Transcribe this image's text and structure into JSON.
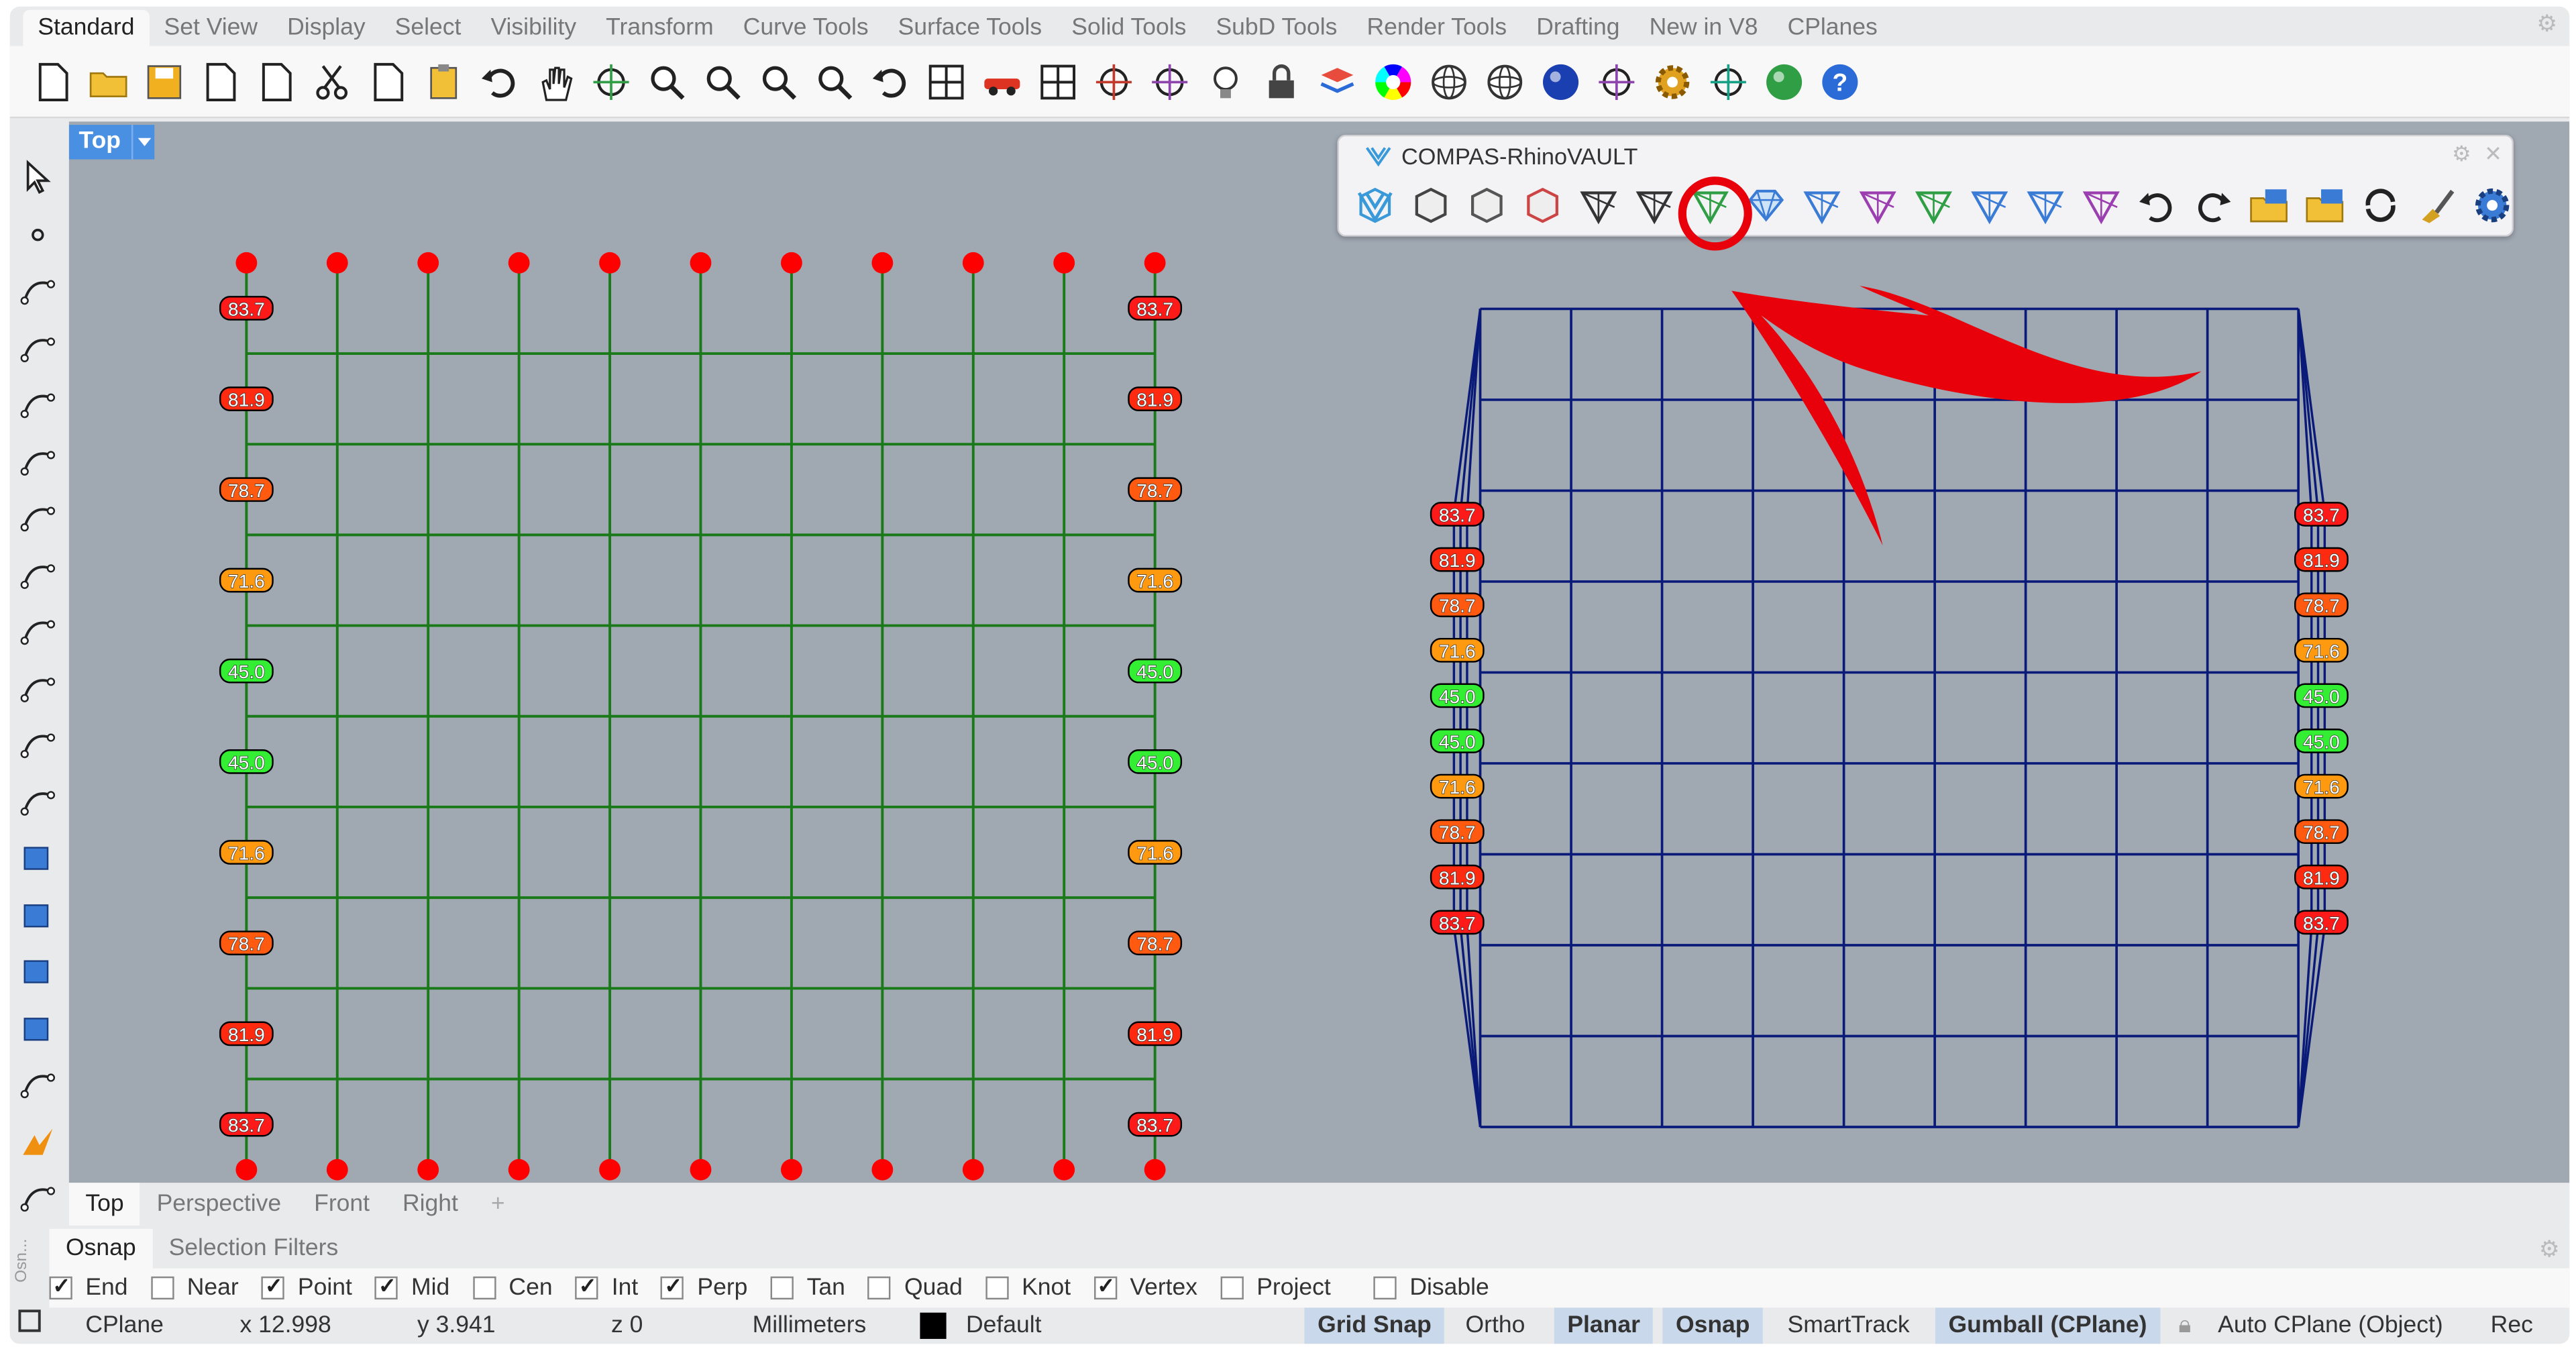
{
  "menu_tabs": [
    "Standard",
    "Set View",
    "Display",
    "Select",
    "Visibility",
    "Transform",
    "Curve Tools",
    "Surface Tools",
    "Solid Tools",
    "SubD Tools",
    "Render Tools",
    "Drafting",
    "New in V8",
    "CPlanes"
  ],
  "toolbar_icons": [
    "new-file-icon",
    "open-folder-icon",
    "save-icon",
    "print-icon",
    "import-icon",
    "cut-icon",
    "copy-icon",
    "paste-icon",
    "undo-icon",
    "pan-hand-icon",
    "rotate-view-icon",
    "zoom-icon",
    "zoom-window-icon",
    "zoom-extents-icon",
    "zoom-selected-icon",
    "undo-view-icon",
    "four-viewports-icon",
    "car-icon",
    "grid-icon",
    "circle-point-icon",
    "point-cloud-icon",
    "lightbulb-icon",
    "lock-icon",
    "layer-icon",
    "color-wheel-icon",
    "sphere-icon",
    "wireframe-sphere-icon",
    "render-sphere-icon",
    "wand-icon",
    "gear-icon",
    "tree-icon",
    "globe-icon",
    "help-icon"
  ],
  "viewport": {
    "label": "Top"
  },
  "panel": {
    "title": "COMPAS-RhinoVAULT",
    "icons": [
      "rv-init-icon",
      "rv-pattern-icon",
      "rv-boundary-icon",
      "rv-supports-icon",
      "rv-form-icon",
      "rv-force-icon",
      "rv-thrust-icon",
      "rv-equilibrium-icon",
      "rv-modify-form-icon",
      "rv-modify-force-icon",
      "rv-modify-thrust-icon",
      "rv-edge-icon",
      "rv-vertex-icon",
      "rv-face-icon",
      "rv-undo-icon",
      "rv-redo-icon",
      "rv-open-icon",
      "rv-save-icon",
      "rv-reload-icon",
      "rv-clear-icon",
      "rv-settings-icon"
    ],
    "highlighted_icon_index": 7
  },
  "left_labels": [
    "83.7",
    "81.9",
    "78.7",
    "71.6",
    "45.0",
    "45.0",
    "71.6",
    "78.7",
    "81.9",
    "83.7"
  ],
  "right_labels": [
    "83.7",
    "81.9",
    "78.7",
    "71.6",
    "45.0",
    "45.0",
    "71.6",
    "78.7",
    "81.9",
    "83.7"
  ],
  "label_colors": {
    "83.7": "#ff1a1a",
    "81.9": "#ff2a10",
    "78.7": "#ff5a10",
    "71.6": "#ff9a10",
    "45.0": "#33ee33"
  },
  "viewport_tabs": [
    "Top",
    "Perspective",
    "Front",
    "Right"
  ],
  "osnap_tabs": [
    "Osnap",
    "Selection Filters"
  ],
  "osnap_items": [
    {
      "label": "End",
      "checked": true
    },
    {
      "label": "Near",
      "checked": false
    },
    {
      "label": "Point",
      "checked": true
    },
    {
      "label": "Mid",
      "checked": true
    },
    {
      "label": "Cen",
      "checked": false
    },
    {
      "label": "Int",
      "checked": true
    },
    {
      "label": "Perp",
      "checked": true
    },
    {
      "label": "Tan",
      "checked": false
    },
    {
      "label": "Quad",
      "checked": false
    },
    {
      "label": "Knot",
      "checked": false
    },
    {
      "label": "Vertex",
      "checked": true
    },
    {
      "label": "Project",
      "checked": false
    },
    {
      "label": "Disable",
      "checked": false
    }
  ],
  "status": {
    "cplane": "CPlane",
    "x": "x 12.998",
    "y": "y 3.941",
    "z": "z 0",
    "units": "Millimeters",
    "layer": "Default",
    "grid_snap": "Grid Snap",
    "ortho": "Ortho",
    "planar": "Planar",
    "osnap": "Osnap",
    "smarttrack": "SmartTrack",
    "gumball": "Gumball (CPlane)",
    "autocplane": "Auto CPlane (Object)",
    "rec": "Rec"
  },
  "colors": {
    "viewport_bg": "#a0a8b2",
    "form_grid": "#1a7a1a",
    "thrust_mesh": "#0a1a78",
    "support_point": "#ff0000",
    "callout": "#e8000a",
    "accent": "#4a90e2"
  }
}
